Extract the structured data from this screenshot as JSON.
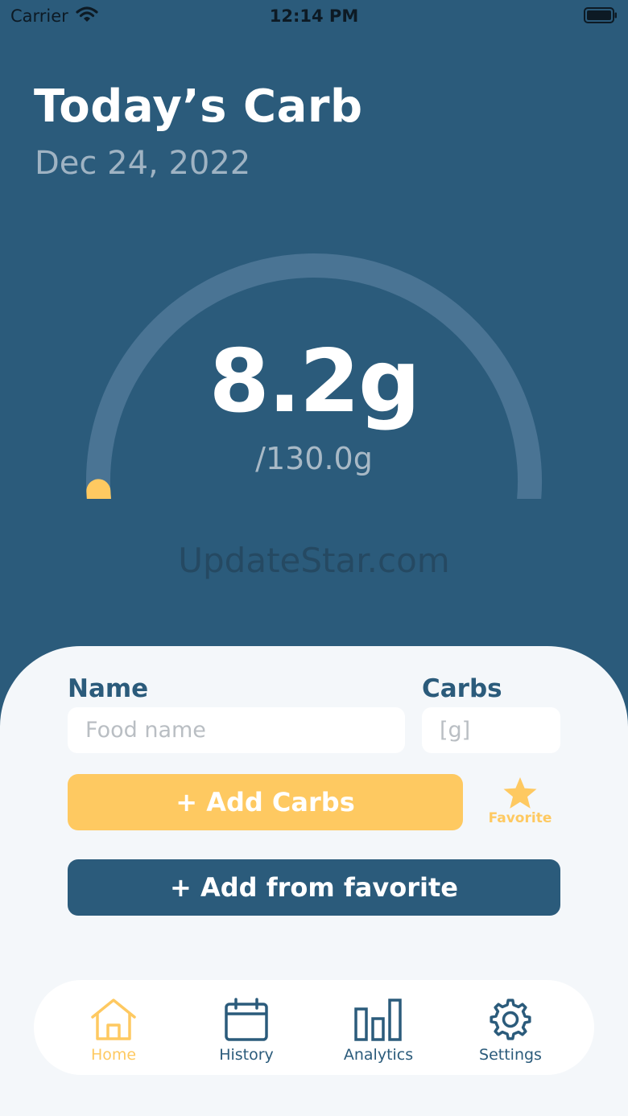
{
  "status_bar": {
    "carrier": "Carrier",
    "time": "12:14 PM"
  },
  "header": {
    "title": "Today’s Carb",
    "date": "Dec 24, 2022"
  },
  "gauge": {
    "value": "8.2g",
    "goal": "/130.0g",
    "progress_fraction": 0.063,
    "track_color": "#4a7494",
    "fill_color": "#fec961"
  },
  "watermark": "UpdateStar.com",
  "form": {
    "name_label": "Name",
    "name_placeholder": "Food name",
    "carbs_label": "Carbs",
    "carbs_placeholder": "[g]",
    "add_carbs_label": "+ Add Carbs",
    "favorite_label": "Favorite",
    "add_from_favorite_label": "+ Add from favorite"
  },
  "tabs": [
    {
      "label": "Home",
      "icon": "home-icon",
      "active": true
    },
    {
      "label": "History",
      "icon": "calendar-icon",
      "active": false
    },
    {
      "label": "Analytics",
      "icon": "bar-chart-icon",
      "active": false
    },
    {
      "label": "Settings",
      "icon": "gear-icon",
      "active": false
    }
  ],
  "colors": {
    "primary": "#2b5b7b",
    "accent": "#fec961",
    "panel": "#f4f7fa"
  }
}
